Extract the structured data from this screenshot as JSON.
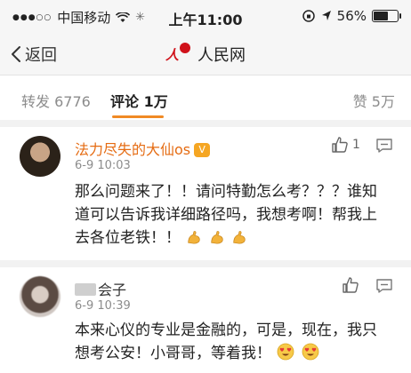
{
  "status_bar": {
    "carrier": "中国移动",
    "time": "上午11:00",
    "battery": "56%"
  },
  "nav": {
    "back_label": "返回",
    "title": "人民网"
  },
  "tabs": {
    "repost": "转发 6776",
    "comment": "评论 1万",
    "like": "赞 5万"
  },
  "comments": [
    {
      "username": "法力尽失的大仙os",
      "badge": "V",
      "date": "6-9 10:03",
      "likes": "1",
      "text": "那么问题来了！！请问特勤怎么考？？？谁知道可以告诉我详细路径吗，我想考啊！帮我上去各位老铁！！",
      "emoji": [
        "flexed-biceps-icon",
        "flexed-biceps-icon",
        "flexed-biceps-icon"
      ]
    },
    {
      "username": "会子",
      "date": "6-9 10:39",
      "likes": "",
      "text": "本来心仪的专业是金融的，可是，现在，我只想考公安！小哥哥，等着我！",
      "emoji": [
        "heart-eyes-icon",
        "heart-eyes-icon"
      ]
    }
  ],
  "colors": {
    "accent": "#f08a24",
    "username_highlight": "#e56b12",
    "logo_red": "#d0121b"
  }
}
